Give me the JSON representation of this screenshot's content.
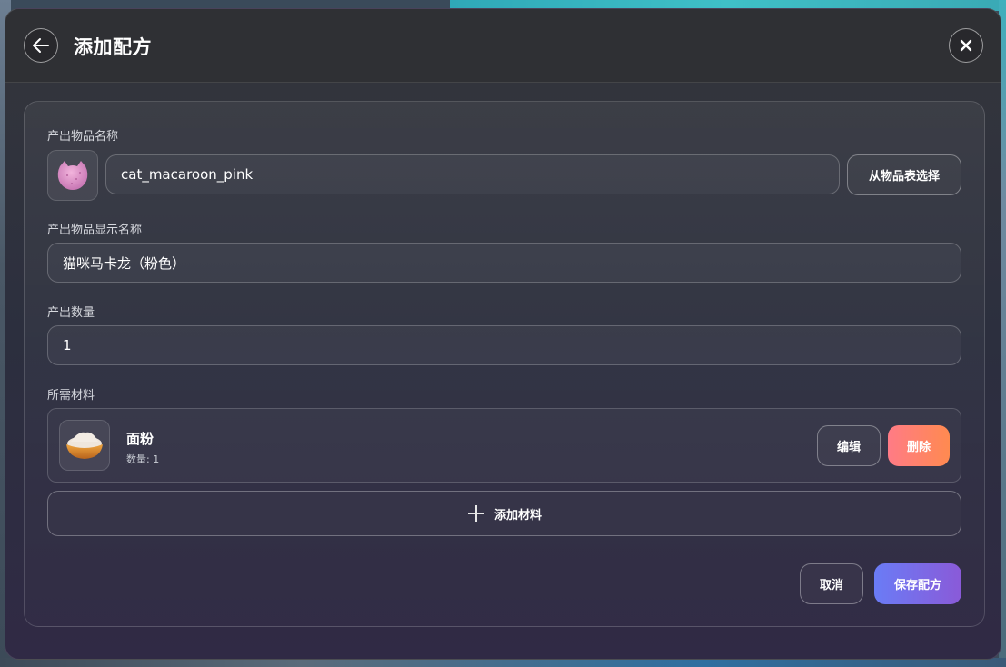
{
  "header": {
    "title": "添加配方"
  },
  "form": {
    "item_name_label": "产出物品名称",
    "item_name_value": "cat_macaroon_pink",
    "select_from_table": "从物品表选择",
    "display_name_label": "产出物品显示名称",
    "display_name_value": "猫咪马卡龙（粉色）",
    "quantity_label": "产出数量",
    "quantity_value": "1",
    "materials_label": "所需材料",
    "materials": [
      {
        "name": "面粉",
        "qty_text": "数量: 1",
        "edit_label": "编辑",
        "delete_label": "删除"
      }
    ],
    "add_material_label": "添加材料"
  },
  "footer": {
    "cancel_label": "取消",
    "save_label": "保存配方"
  },
  "icons": {
    "back": "arrow-left-icon",
    "close": "close-icon",
    "item": "cat-macaroon-icon",
    "material": "flour-bowl-icon",
    "add": "plus-icon"
  }
}
